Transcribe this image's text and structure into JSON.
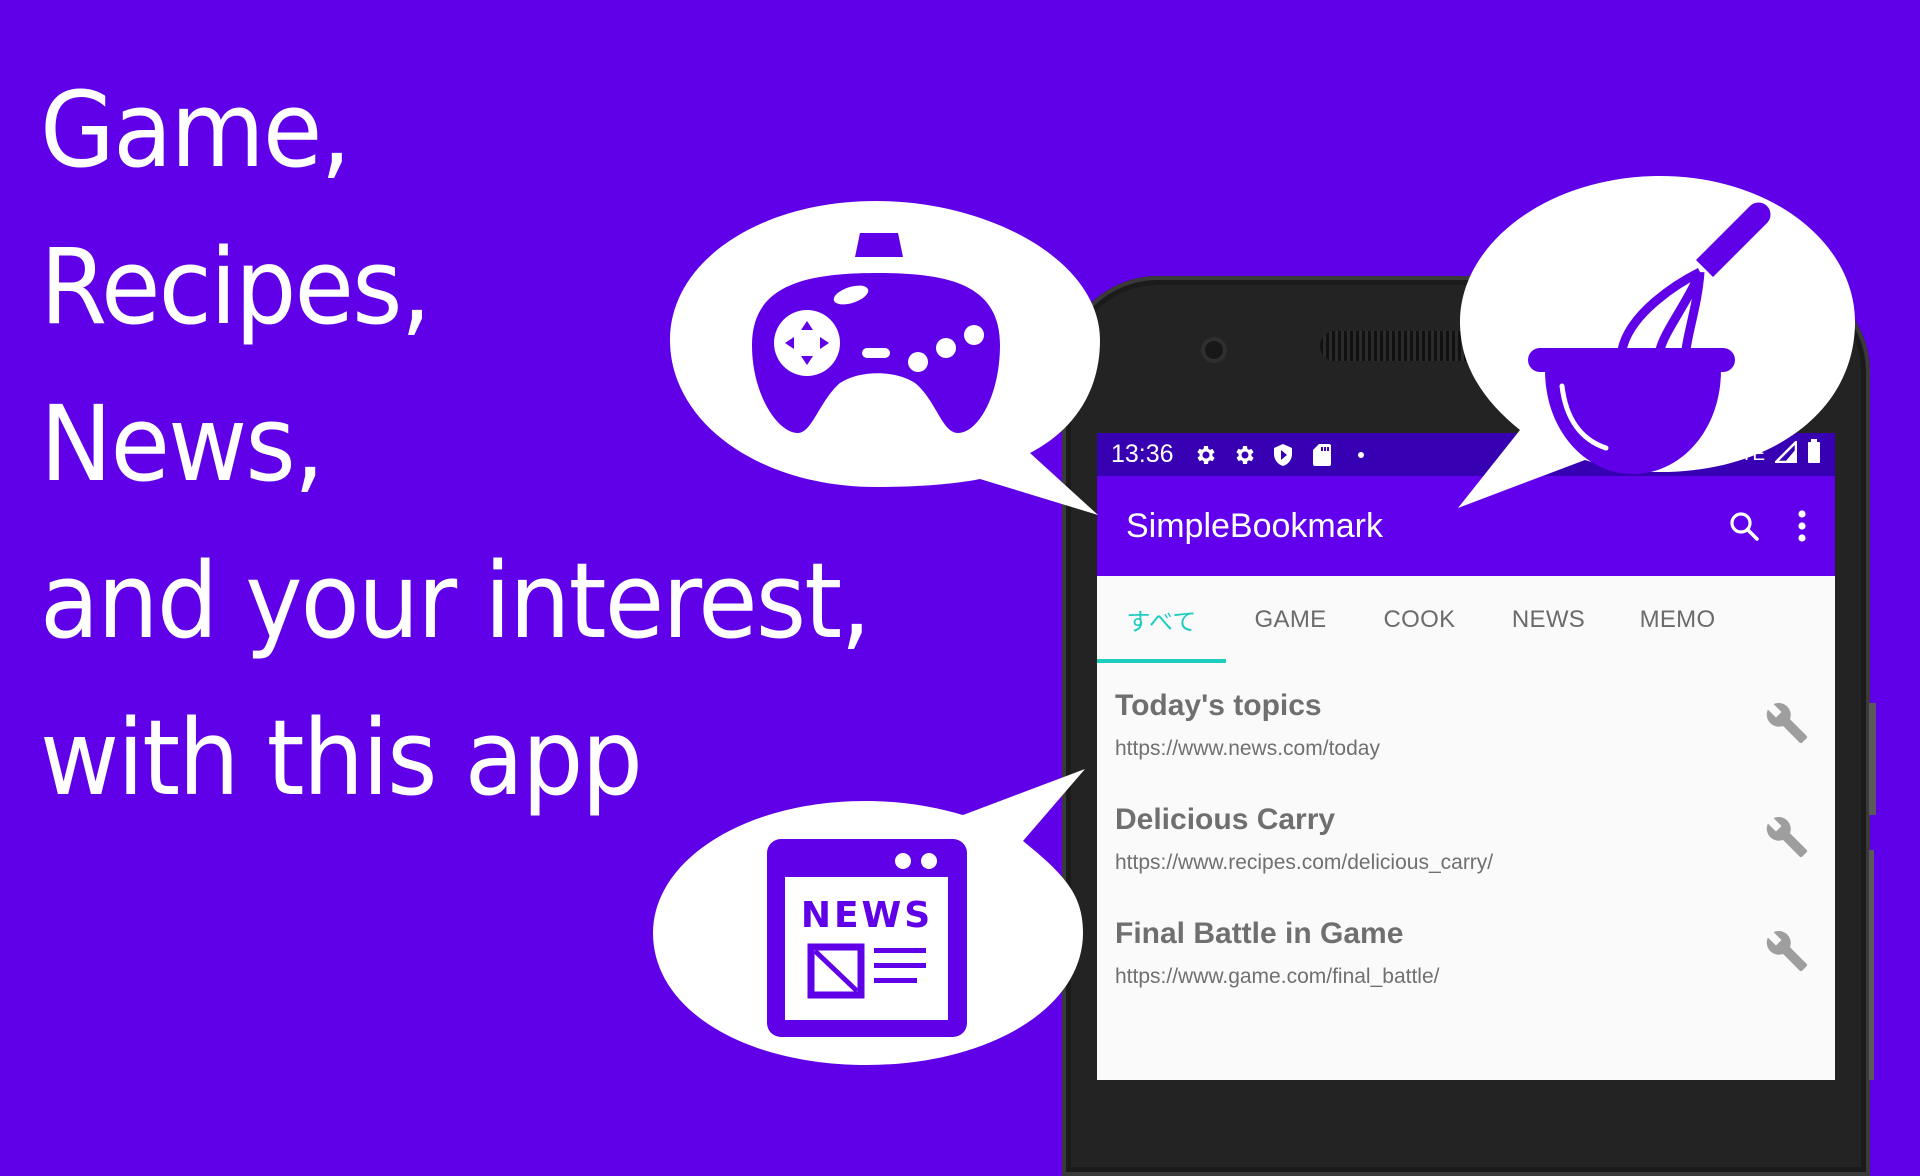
{
  "headline": {
    "lines": [
      "Game,",
      "Recipes,",
      "News,",
      "and your interest,",
      "with this app"
    ]
  },
  "colors": {
    "background": "#5f00e8",
    "primary": "#6200ee",
    "primary_dark": "#3700b3",
    "tab_accent": "#1fcdc0",
    "list_text": "#6f6f6f",
    "bubble": "#ffffff"
  },
  "bubbles": [
    {
      "icon": "gamepad-icon"
    },
    {
      "icon": "whisk-bowl-icon"
    },
    {
      "icon": "newspaper-icon",
      "label": "NEWS"
    }
  ],
  "phone": {
    "status_bar": {
      "time": "13:36",
      "icons": [
        "gear-icon",
        "gear-icon",
        "shield-play-icon",
        "sd-card-icon",
        "dot-icon"
      ],
      "network": "LTE",
      "right_icons": [
        "signal-icon",
        "battery-icon"
      ]
    },
    "app_bar": {
      "title": "SimpleBookmark",
      "actions": [
        "search-icon",
        "more-vert-icon"
      ]
    },
    "tabs": [
      {
        "label": "すべて",
        "active": true
      },
      {
        "label": "GAME",
        "active": false
      },
      {
        "label": "COOK",
        "active": false
      },
      {
        "label": "NEWS",
        "active": false
      },
      {
        "label": "MEMO",
        "active": false
      }
    ],
    "bookmarks": [
      {
        "title": "Today's topics",
        "url": "https://www.news.com/today"
      },
      {
        "title": "Delicious Carry",
        "url": "https://www.recipes.com/delicious_carry/"
      },
      {
        "title": "Final Battle in Game",
        "url": "https://www.game.com/final_battle/"
      }
    ]
  }
}
